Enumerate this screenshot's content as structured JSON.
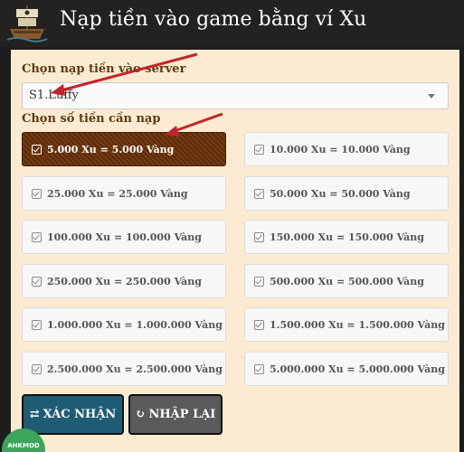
{
  "header": {
    "title": "Nạp tiền vào game bằng ví Xu"
  },
  "server": {
    "label": "Chọn nạp tiền vào server",
    "selected": "S1.Luffy"
  },
  "amount": {
    "label": "Chọn số tiền cần nạp",
    "selected_index": 0,
    "options": [
      "5.000 Xu = 5.000 Vàng",
      "10.000 Xu = 10.000 Vàng",
      "25.000 Xu = 25.000 Vàng",
      "50.000 Xu = 50.000 Vàng",
      "100.000 Xu = 100.000 Vàng",
      "150.000 Xu = 150.000 Vàng",
      "250.000 Xu = 250.000 Vàng",
      "500.000 Xu = 500.000 Vàng",
      "1.000.000 Xu = 1.000.000 Vàng",
      "1.500.000 Xu = 1.500.000 Vàng",
      "2.500.000 Xu = 2.500.000 Vàng",
      "5.000.000 Xu = 5.000.000 Vàng"
    ]
  },
  "buttons": {
    "confirm_icon": "⇄",
    "confirm": "XÁC NHẬN",
    "reset_icon": "↻",
    "reset": "NHẬP LẠI"
  },
  "colors": {
    "selected_option": "#6b3109",
    "confirm_button": "#1f5c74",
    "reset_button": "#5a5a5a",
    "panel_background": "#fcebd2",
    "annotation_arrow": "#c0262b"
  },
  "watermark": {
    "text": "AHKMOD"
  }
}
